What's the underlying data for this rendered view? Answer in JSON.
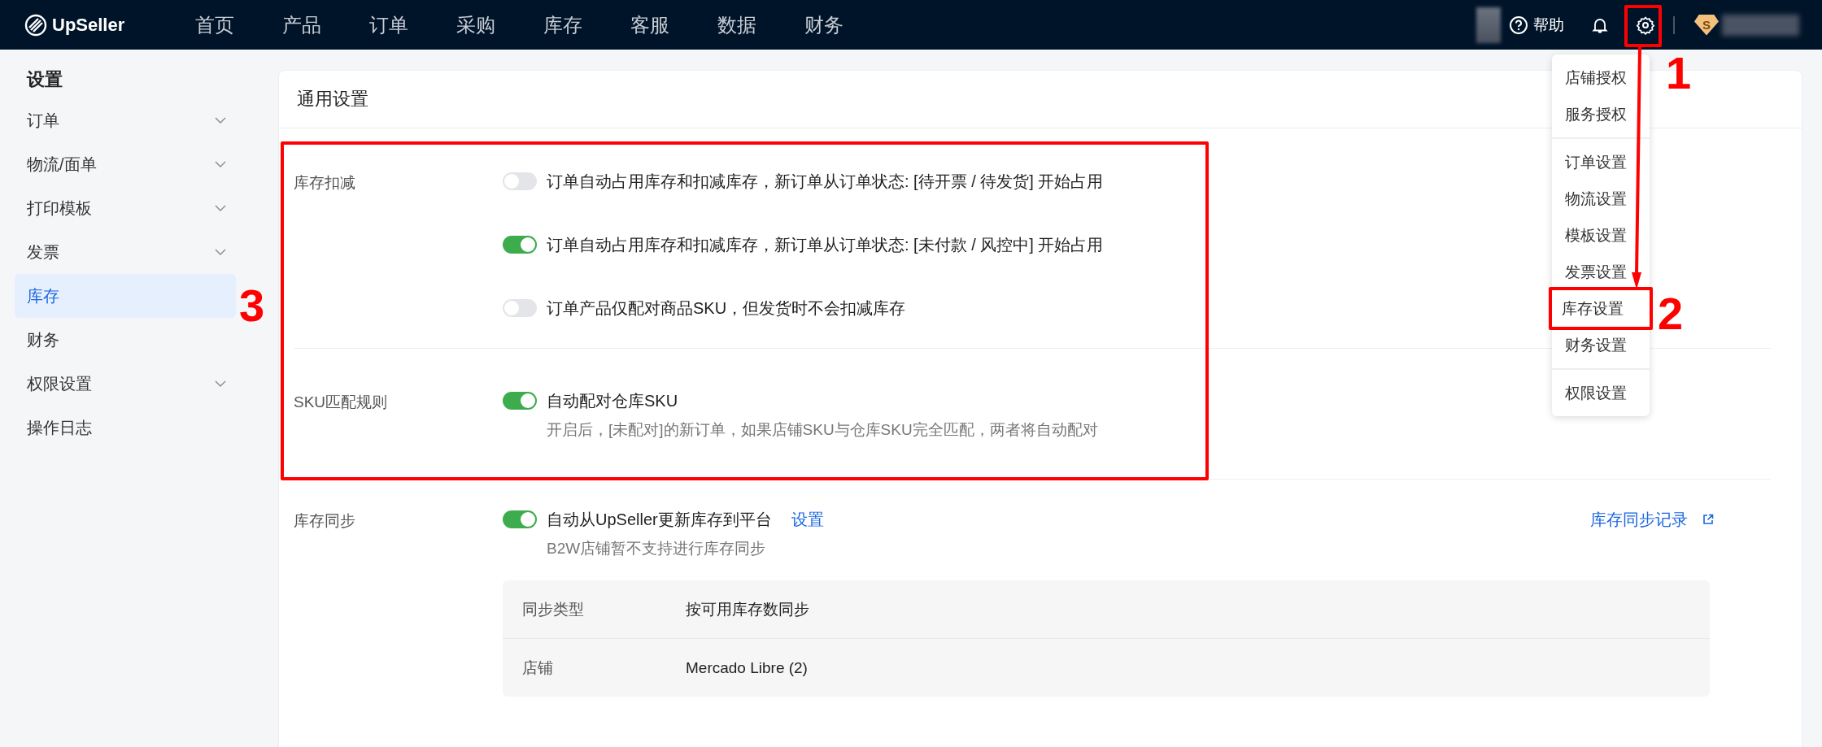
{
  "top_bar": {
    "logo": "UpSeller",
    "nav": [
      {
        "label": "首页",
        "selected": false
      },
      {
        "label": "产品",
        "selected": false
      },
      {
        "label": "订单",
        "selected": false
      },
      {
        "label": "采购",
        "selected": false
      },
      {
        "label": "库存",
        "selected": false
      },
      {
        "label": "客服",
        "selected": false
      },
      {
        "label": "数据",
        "selected": false
      },
      {
        "label": "财务",
        "selected": false
      }
    ],
    "help": "帮助",
    "badge": "S"
  },
  "sidebar": {
    "title": "设置",
    "items": [
      {
        "label": "订单",
        "kind": "group",
        "selected": false
      },
      {
        "label": "物流/面单",
        "kind": "group",
        "selected": false
      },
      {
        "label": "打印模板",
        "kind": "group",
        "selected": false
      },
      {
        "label": "发票",
        "kind": "group",
        "selected": false
      },
      {
        "label": "库存",
        "kind": "link",
        "selected": true
      },
      {
        "label": "财务",
        "kind": "link",
        "selected": false
      },
      {
        "label": "权限设置",
        "kind": "group",
        "selected": false
      },
      {
        "label": "操作日志",
        "kind": "link",
        "selected": false
      }
    ]
  },
  "card": {
    "title": "通用设置",
    "sections": [
      {
        "label": "库存扣减",
        "options": [
          {
            "text": "订单自动占用库存和扣减库存，新订单从订单状态: [待开票 / 待发货] 开始占用",
            "on": false
          },
          {
            "text": "订单自动占用库存和扣减库存，新订单从订单状态: [未付款 / 风控中] 开始占用",
            "on": true
          },
          {
            "text": "订单产品仅配对商品SKU，但发货时不会扣减库存",
            "on": false
          }
        ]
      },
      {
        "label": "SKU匹配规则",
        "options": [
          {
            "text": "自动配对仓库SKU",
            "on": true,
            "description": "开启后，[未配对]的新订单，如果店铺SKU与仓库SKU完全匹配，两者将自动配对"
          }
        ]
      },
      {
        "label": "库存同步",
        "options": [
          {
            "text": "自动从UpSeller更新库存到平台",
            "on": true,
            "link": "设置",
            "description": "B2W店铺暂不支持进行库存同步"
          }
        ],
        "record_link": "库存同步记录",
        "table": [
          {
            "key": "同步类型",
            "value": "按可用库存数同步"
          },
          {
            "key": "店铺",
            "value": "Mercado Libre (2)"
          }
        ]
      }
    ]
  },
  "settings_menu": {
    "groups": [
      [
        {
          "label": "店铺授权",
          "selected": false
        },
        {
          "label": "服务授权",
          "selected": false
        }
      ],
      [
        {
          "label": "订单设置",
          "selected": false
        },
        {
          "label": "物流设置",
          "selected": false
        },
        {
          "label": "模板设置",
          "selected": false
        },
        {
          "label": "发票设置",
          "selected": false
        },
        {
          "label": "库存设置",
          "selected": false
        },
        {
          "label": "财务设置",
          "selected": false
        }
      ],
      [
        {
          "label": "权限设置",
          "selected": false
        }
      ]
    ]
  },
  "annotations": [
    {
      "label": "1"
    },
    {
      "label": "2"
    },
    {
      "label": "3"
    }
  ]
}
